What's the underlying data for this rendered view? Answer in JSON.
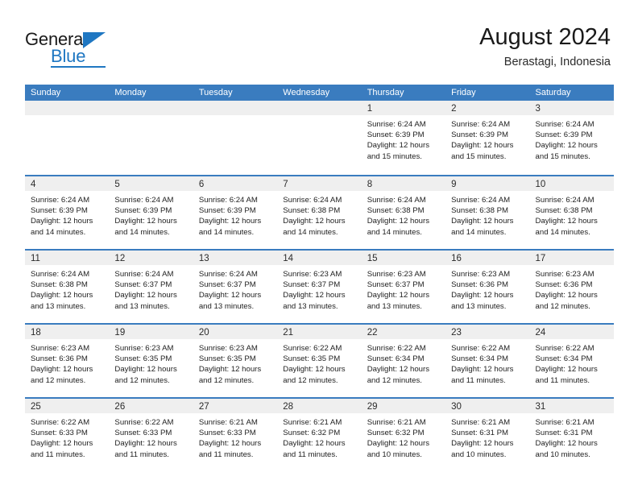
{
  "brand": {
    "name_part1": "General",
    "name_part2": "Blue",
    "color_primary": "#1f77c2"
  },
  "header": {
    "title": "August 2024",
    "subtitle": "Berastagi, Indonesia"
  },
  "theme": {
    "header_row_bg": "#3a7cbf",
    "day_band_bg": "#efefef",
    "row_divider": "#3a7cbf"
  },
  "weekdays": [
    "Sunday",
    "Monday",
    "Tuesday",
    "Wednesday",
    "Thursday",
    "Friday",
    "Saturday"
  ],
  "weeks": [
    [
      {
        "day": "",
        "lines": []
      },
      {
        "day": "",
        "lines": []
      },
      {
        "day": "",
        "lines": []
      },
      {
        "day": "",
        "lines": []
      },
      {
        "day": "1",
        "lines": [
          "Sunrise: 6:24 AM",
          "Sunset: 6:39 PM",
          "Daylight: 12 hours",
          "and 15 minutes."
        ]
      },
      {
        "day": "2",
        "lines": [
          "Sunrise: 6:24 AM",
          "Sunset: 6:39 PM",
          "Daylight: 12 hours",
          "and 15 minutes."
        ]
      },
      {
        "day": "3",
        "lines": [
          "Sunrise: 6:24 AM",
          "Sunset: 6:39 PM",
          "Daylight: 12 hours",
          "and 15 minutes."
        ]
      }
    ],
    [
      {
        "day": "4",
        "lines": [
          "Sunrise: 6:24 AM",
          "Sunset: 6:39 PM",
          "Daylight: 12 hours",
          "and 14 minutes."
        ]
      },
      {
        "day": "5",
        "lines": [
          "Sunrise: 6:24 AM",
          "Sunset: 6:39 PM",
          "Daylight: 12 hours",
          "and 14 minutes."
        ]
      },
      {
        "day": "6",
        "lines": [
          "Sunrise: 6:24 AM",
          "Sunset: 6:39 PM",
          "Daylight: 12 hours",
          "and 14 minutes."
        ]
      },
      {
        "day": "7",
        "lines": [
          "Sunrise: 6:24 AM",
          "Sunset: 6:38 PM",
          "Daylight: 12 hours",
          "and 14 minutes."
        ]
      },
      {
        "day": "8",
        "lines": [
          "Sunrise: 6:24 AM",
          "Sunset: 6:38 PM",
          "Daylight: 12 hours",
          "and 14 minutes."
        ]
      },
      {
        "day": "9",
        "lines": [
          "Sunrise: 6:24 AM",
          "Sunset: 6:38 PM",
          "Daylight: 12 hours",
          "and 14 minutes."
        ]
      },
      {
        "day": "10",
        "lines": [
          "Sunrise: 6:24 AM",
          "Sunset: 6:38 PM",
          "Daylight: 12 hours",
          "and 14 minutes."
        ]
      }
    ],
    [
      {
        "day": "11",
        "lines": [
          "Sunrise: 6:24 AM",
          "Sunset: 6:38 PM",
          "Daylight: 12 hours",
          "and 13 minutes."
        ]
      },
      {
        "day": "12",
        "lines": [
          "Sunrise: 6:24 AM",
          "Sunset: 6:37 PM",
          "Daylight: 12 hours",
          "and 13 minutes."
        ]
      },
      {
        "day": "13",
        "lines": [
          "Sunrise: 6:24 AM",
          "Sunset: 6:37 PM",
          "Daylight: 12 hours",
          "and 13 minutes."
        ]
      },
      {
        "day": "14",
        "lines": [
          "Sunrise: 6:23 AM",
          "Sunset: 6:37 PM",
          "Daylight: 12 hours",
          "and 13 minutes."
        ]
      },
      {
        "day": "15",
        "lines": [
          "Sunrise: 6:23 AM",
          "Sunset: 6:37 PM",
          "Daylight: 12 hours",
          "and 13 minutes."
        ]
      },
      {
        "day": "16",
        "lines": [
          "Sunrise: 6:23 AM",
          "Sunset: 6:36 PM",
          "Daylight: 12 hours",
          "and 13 minutes."
        ]
      },
      {
        "day": "17",
        "lines": [
          "Sunrise: 6:23 AM",
          "Sunset: 6:36 PM",
          "Daylight: 12 hours",
          "and 12 minutes."
        ]
      }
    ],
    [
      {
        "day": "18",
        "lines": [
          "Sunrise: 6:23 AM",
          "Sunset: 6:36 PM",
          "Daylight: 12 hours",
          "and 12 minutes."
        ]
      },
      {
        "day": "19",
        "lines": [
          "Sunrise: 6:23 AM",
          "Sunset: 6:35 PM",
          "Daylight: 12 hours",
          "and 12 minutes."
        ]
      },
      {
        "day": "20",
        "lines": [
          "Sunrise: 6:23 AM",
          "Sunset: 6:35 PM",
          "Daylight: 12 hours",
          "and 12 minutes."
        ]
      },
      {
        "day": "21",
        "lines": [
          "Sunrise: 6:22 AM",
          "Sunset: 6:35 PM",
          "Daylight: 12 hours",
          "and 12 minutes."
        ]
      },
      {
        "day": "22",
        "lines": [
          "Sunrise: 6:22 AM",
          "Sunset: 6:34 PM",
          "Daylight: 12 hours",
          "and 12 minutes."
        ]
      },
      {
        "day": "23",
        "lines": [
          "Sunrise: 6:22 AM",
          "Sunset: 6:34 PM",
          "Daylight: 12 hours",
          "and 11 minutes."
        ]
      },
      {
        "day": "24",
        "lines": [
          "Sunrise: 6:22 AM",
          "Sunset: 6:34 PM",
          "Daylight: 12 hours",
          "and 11 minutes."
        ]
      }
    ],
    [
      {
        "day": "25",
        "lines": [
          "Sunrise: 6:22 AM",
          "Sunset: 6:33 PM",
          "Daylight: 12 hours",
          "and 11 minutes."
        ]
      },
      {
        "day": "26",
        "lines": [
          "Sunrise: 6:22 AM",
          "Sunset: 6:33 PM",
          "Daylight: 12 hours",
          "and 11 minutes."
        ]
      },
      {
        "day": "27",
        "lines": [
          "Sunrise: 6:21 AM",
          "Sunset: 6:33 PM",
          "Daylight: 12 hours",
          "and 11 minutes."
        ]
      },
      {
        "day": "28",
        "lines": [
          "Sunrise: 6:21 AM",
          "Sunset: 6:32 PM",
          "Daylight: 12 hours",
          "and 11 minutes."
        ]
      },
      {
        "day": "29",
        "lines": [
          "Sunrise: 6:21 AM",
          "Sunset: 6:32 PM",
          "Daylight: 12 hours",
          "and 10 minutes."
        ]
      },
      {
        "day": "30",
        "lines": [
          "Sunrise: 6:21 AM",
          "Sunset: 6:31 PM",
          "Daylight: 12 hours",
          "and 10 minutes."
        ]
      },
      {
        "day": "31",
        "lines": [
          "Sunrise: 6:21 AM",
          "Sunset: 6:31 PM",
          "Daylight: 12 hours",
          "and 10 minutes."
        ]
      }
    ]
  ]
}
